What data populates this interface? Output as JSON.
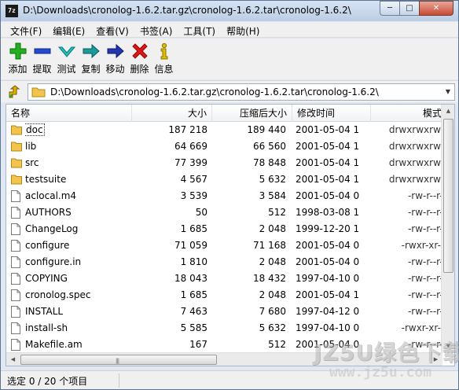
{
  "window": {
    "title": "D:\\Downloads\\cronolog-1.6.2.tar.gz\\cronolog-1.6.2.tar\\cronolog-1.6.2\\",
    "app_icon": "7z",
    "minimize": "─",
    "maximize": "□",
    "close": "✕"
  },
  "menu": [
    {
      "label": "文件(F)"
    },
    {
      "label": "编辑(E)"
    },
    {
      "label": "查看(V)"
    },
    {
      "label": "书签(A)"
    },
    {
      "label": "工具(T)"
    },
    {
      "label": "帮助(H)"
    }
  ],
  "toolbar": [
    {
      "label": "添加",
      "icon": "plus-icon",
      "color": "#1aa51a"
    },
    {
      "label": "提取",
      "icon": "minus-icon",
      "color": "#1f3fbf"
    },
    {
      "label": "测试",
      "icon": "check-icon",
      "color": "#1aa5a5"
    },
    {
      "label": "复制",
      "icon": "copy-arrow-icon",
      "color": "#1a8a8a"
    },
    {
      "label": "移动",
      "icon": "move-arrow-icon",
      "color": "#1f2f9f"
    },
    {
      "label": "删除",
      "icon": "delete-x-icon",
      "color": "#d01010"
    },
    {
      "label": "信息",
      "icon": "info-icon",
      "color": "#d4b000"
    }
  ],
  "address": {
    "value": "D:\\Downloads\\cronolog-1.6.2.tar.gz\\cronolog-1.6.2.tar\\cronolog-1.6.2\\"
  },
  "columns": {
    "name": "名称",
    "size": "大小",
    "packed": "压缩后大小",
    "modified": "修改时间",
    "attributes": "模式"
  },
  "files": [
    {
      "name": "doc",
      "type": "folder",
      "size": "187 218",
      "packed": "189 440",
      "modified": "2001-05-04 1",
      "attr": "drwxrwxrwx"
    },
    {
      "name": "lib",
      "type": "folder",
      "size": "64 669",
      "packed": "66 560",
      "modified": "2001-05-04 1",
      "attr": "drwxrwxrwx"
    },
    {
      "name": "src",
      "type": "folder",
      "size": "77 399",
      "packed": "78 848",
      "modified": "2001-05-04 1",
      "attr": "drwxrwxrwx"
    },
    {
      "name": "testsuite",
      "type": "folder",
      "size": "4 567",
      "packed": "5 632",
      "modified": "2001-05-04 1",
      "attr": "drwxrwxrwx"
    },
    {
      "name": "aclocal.m4",
      "type": "file",
      "size": "3 539",
      "packed": "3 584",
      "modified": "2001-05-04 0",
      "attr": "-rw-r--r--"
    },
    {
      "name": "AUTHORS",
      "type": "file",
      "size": "50",
      "packed": "512",
      "modified": "1998-03-08 1",
      "attr": "-rw-r--r--"
    },
    {
      "name": "ChangeLog",
      "type": "file",
      "size": "1 685",
      "packed": "2 048",
      "modified": "1999-12-20 1",
      "attr": "-rw-r--r--"
    },
    {
      "name": "configure",
      "type": "file",
      "size": "71 059",
      "packed": "71 168",
      "modified": "2001-05-04 0",
      "attr": "-rwxr-xr-x"
    },
    {
      "name": "configure.in",
      "type": "file",
      "size": "1 810",
      "packed": "2 048",
      "modified": "2001-05-04 0",
      "attr": "-rw-r--r--"
    },
    {
      "name": "COPYING",
      "type": "file",
      "size": "18 043",
      "packed": "18 432",
      "modified": "1997-04-10 0",
      "attr": "-rw-r--r--"
    },
    {
      "name": "cronolog.spec",
      "type": "file",
      "size": "1 685",
      "packed": "2 048",
      "modified": "2001-05-04 1",
      "attr": "-rw-r--r--"
    },
    {
      "name": "INSTALL",
      "type": "file",
      "size": "7 463",
      "packed": "7 680",
      "modified": "1997-04-12 0",
      "attr": "-rw-r--r--"
    },
    {
      "name": "install-sh",
      "type": "file",
      "size": "5 585",
      "packed": "5 632",
      "modified": "1997-04-10 0",
      "attr": "-rwxr-xr-x"
    },
    {
      "name": "Makefile.am",
      "type": "file",
      "size": "167",
      "packed": "512",
      "modified": "2001-05-04 0",
      "attr": "-rw-r--r--"
    }
  ],
  "status": {
    "text": "选定 0 / 20 个项目"
  },
  "watermark": {
    "line1": "JZ5U绿色下载",
    "line2": "www.jz5u.com"
  }
}
